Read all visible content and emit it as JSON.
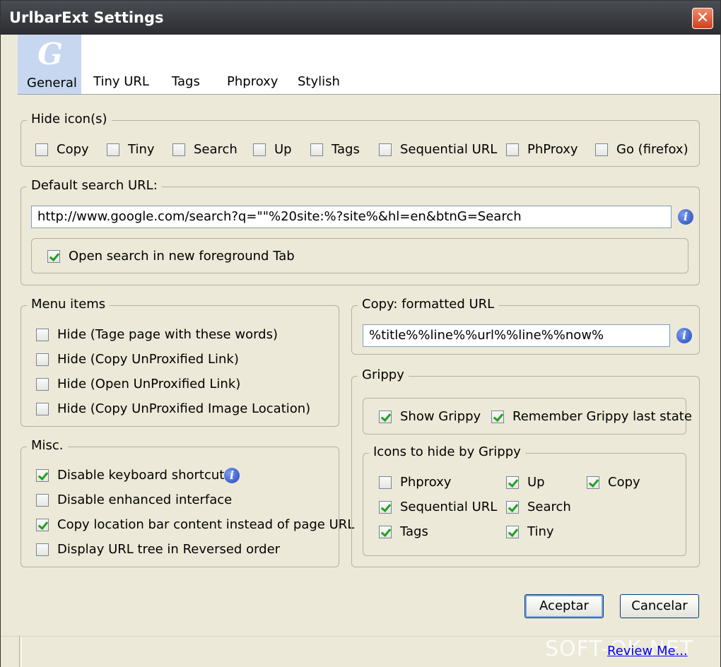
{
  "window": {
    "title": "UrlbarExt Settings",
    "close_glyph": "✕"
  },
  "tabs": [
    {
      "label": "General",
      "logo": "G"
    },
    {
      "label": "Tiny URL"
    },
    {
      "label": "Tags"
    },
    {
      "label": "Phproxy"
    },
    {
      "label": "Stylish"
    }
  ],
  "hide_icons": {
    "legend": "Hide icon(s)",
    "items": [
      {
        "label": "Copy",
        "checked": false
      },
      {
        "label": "Tiny",
        "checked": false
      },
      {
        "label": "Search",
        "checked": false
      },
      {
        "label": "Up",
        "checked": false
      },
      {
        "label": "Tags",
        "checked": false
      },
      {
        "label": "Sequential URL",
        "checked": false
      },
      {
        "label": "PhProxy",
        "checked": false
      },
      {
        "label": "Go (firefox)",
        "checked": false
      }
    ]
  },
  "default_search": {
    "legend": "Default search URL:",
    "value": "http://www.google.com/search?q=\"\"%20site:%?site%&hl=en&btnG=Search",
    "open_new_tab": {
      "label": "Open search in new foreground Tab",
      "checked": true
    }
  },
  "menu_items": {
    "legend": "Menu items",
    "items": [
      {
        "label": "Hide (Tage page with these words)",
        "checked": false
      },
      {
        "label": "Hide (Copy UnProxified Link)",
        "checked": false
      },
      {
        "label": "Hide (Open UnProxified Link)",
        "checked": false
      },
      {
        "label": "Hide (Copy UnProxified Image Location)",
        "checked": false
      }
    ]
  },
  "misc": {
    "legend": "Misc.",
    "items": [
      {
        "label": "Disable keyboard shortcuts",
        "checked": true
      },
      {
        "label": "Disable enhanced interface",
        "checked": false
      },
      {
        "label": "Copy location bar content instead of page URL",
        "checked": true
      },
      {
        "label": "Display URL tree in Reversed order",
        "checked": false
      }
    ]
  },
  "copy_formatted": {
    "legend": "Copy: formatted URL",
    "value": "%title%%line%%url%%line%%now%"
  },
  "grippy": {
    "legend": "Grippy",
    "show": {
      "label": "Show Grippy",
      "checked": true
    },
    "remember": {
      "label": "Remember Grippy last state",
      "checked": true
    },
    "icons_legend": "Icons to hide by Grippy",
    "icons": [
      {
        "label": "Phproxy",
        "checked": false
      },
      {
        "label": "Up",
        "checked": true
      },
      {
        "label": "Copy",
        "checked": true
      },
      {
        "label": "Sequential URL",
        "checked": true
      },
      {
        "label": "Search",
        "checked": true
      },
      {
        "label": "Tags",
        "checked": true
      },
      {
        "label": "Tiny",
        "checked": true
      }
    ]
  },
  "buttons": {
    "ok": "Aceptar",
    "cancel": "Cancelar"
  },
  "status": {
    "review_link": "Review Me...",
    "watermark": "SOFT-OK.NET"
  },
  "info_glyph": "i"
}
